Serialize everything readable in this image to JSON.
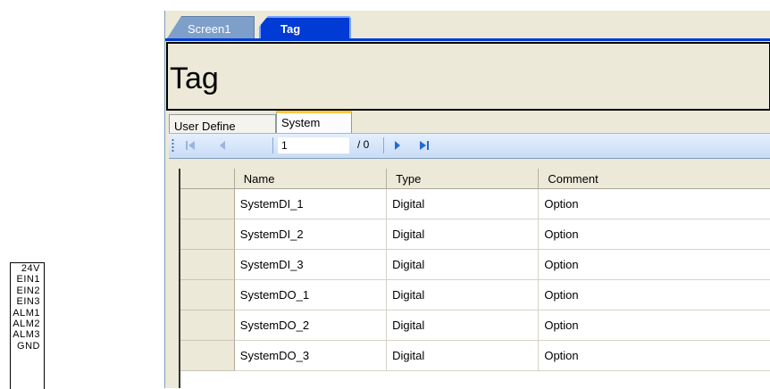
{
  "terminal_labels": [
    "24V",
    "EIN1",
    "EIN2",
    "EIN3",
    "ALM1",
    "ALM2",
    "ALM3",
    "GND"
  ],
  "document_tabs": [
    {
      "label": "Screen1",
      "active": false
    },
    {
      "label": "Tag",
      "active": true
    }
  ],
  "page_title": "Tag",
  "sub_tabs": [
    {
      "label": "User Define",
      "active": false
    },
    {
      "label": "System",
      "active": true
    }
  ],
  "pager": {
    "current_page": "1",
    "total_label": "/ 0",
    "icons": [
      "move-first-icon",
      "move-previous-icon",
      "move-next-icon",
      "move-last-icon"
    ]
  },
  "grid": {
    "columns": [
      "Name",
      "Type",
      "Comment"
    ],
    "rows": [
      [
        "SystemDI_1",
        "Digital",
        "Option"
      ],
      [
        "SystemDI_2",
        "Digital",
        "Option"
      ],
      [
        "SystemDI_3",
        "Digital",
        "Option"
      ],
      [
        "SystemDO_1",
        "Digital",
        "Option"
      ],
      [
        "SystemDO_2",
        "Digital",
        "Option"
      ],
      [
        "SystemDO_3",
        "Digital",
        "Option"
      ]
    ]
  },
  "colors": {
    "active_tab": "#003bd6",
    "inactive_tab": "#7e9fc9",
    "panel": "#ece9d8",
    "selected_subtab_accent": "#ffc83c"
  }
}
